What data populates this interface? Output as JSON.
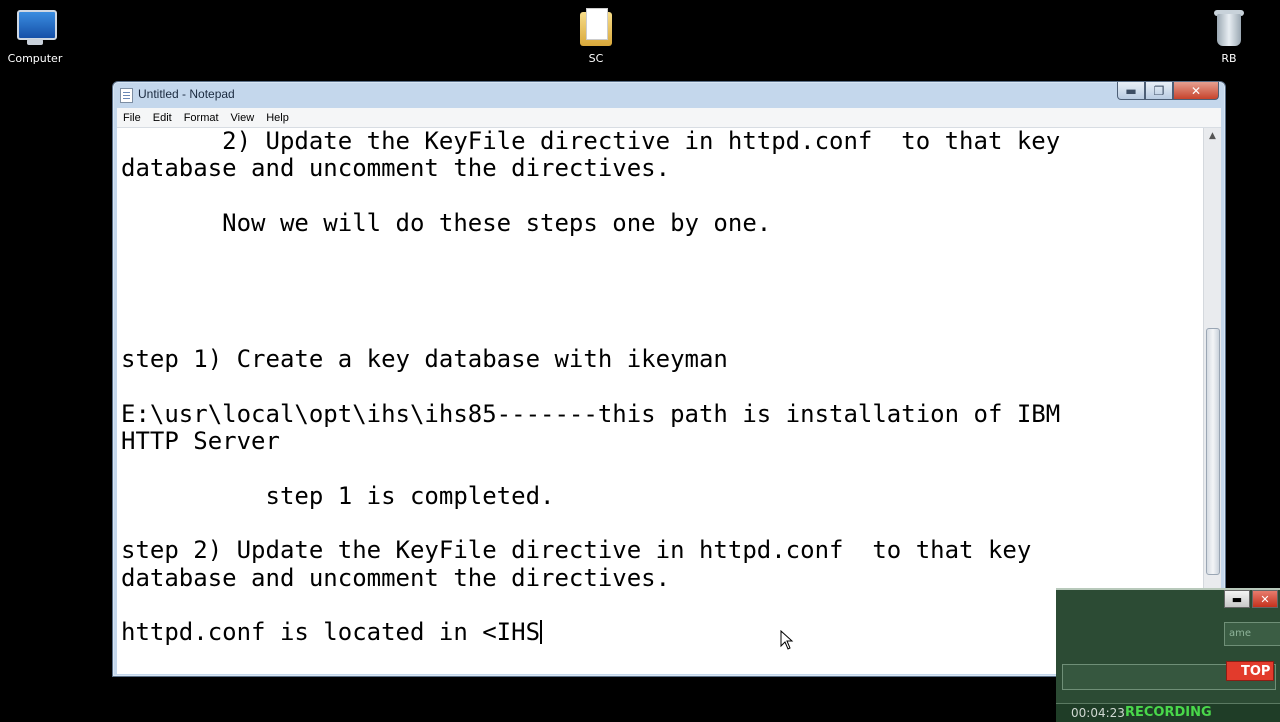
{
  "desktop": {
    "icons": [
      {
        "label": "Computer"
      },
      {
        "label": "SC"
      },
      {
        "label": "RB"
      }
    ]
  },
  "window": {
    "title": "Untitled - Notepad",
    "controls": {
      "minimize": "▬",
      "maximize": "❐",
      "close": "✕"
    }
  },
  "menu": [
    "File",
    "Edit",
    "Format",
    "View",
    "Help"
  ],
  "editor": {
    "lines": [
      "       2) Update the KeyFile directive in httpd.conf  to that key",
      "database and uncomment the directives.",
      "",
      "       Now we will do these steps one by one.",
      "",
      "",
      "",
      "",
      "step 1) Create a key database with ikeyman",
      "",
      "E:\\usr\\local\\opt\\ihs\\ihs85-------this path is installation of IBM",
      "HTTP Server",
      "",
      "          step 1 is completed.",
      "",
      "step 2) Update the KeyFile directive in httpd.conf  to that key",
      "database and uncomment the directives.",
      "",
      "httpd.conf is located in <IHS"
    ]
  },
  "recorder": {
    "field_text": "ame",
    "stop_label": "TOP",
    "time": "00:04:23",
    "status": "RECORDING"
  }
}
